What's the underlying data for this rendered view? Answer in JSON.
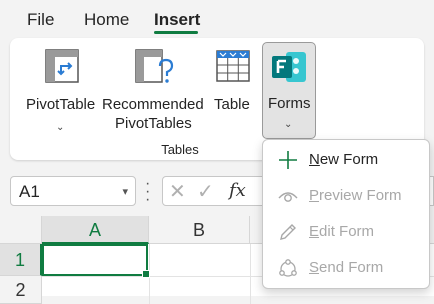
{
  "ribbon_tabs": [
    {
      "label": "File"
    },
    {
      "label": "Home"
    },
    {
      "label": "Insert",
      "active": true
    }
  ],
  "ribbon": {
    "pivottable": {
      "label": "PivotTable",
      "icon": "pivottable-icon"
    },
    "recommended": {
      "label_line1": "Recommended",
      "label_line2": "PivotTables",
      "icon": "recommended-pivottables-icon"
    },
    "table": {
      "label": "Table",
      "icon": "table-icon"
    },
    "forms": {
      "label": "Forms",
      "icon": "microsoft-forms-icon"
    },
    "group_label": "Tables"
  },
  "formula_bar": {
    "name_box": "A1",
    "fx": "fx"
  },
  "grid": {
    "columns": [
      "A",
      "B"
    ],
    "rows": [
      "1",
      "2"
    ],
    "selected_cell": "A1"
  },
  "forms_menu": {
    "items": [
      {
        "accel": "N",
        "rest": "ew Form",
        "enabled": true,
        "icon": "plus-icon"
      },
      {
        "accel": "P",
        "rest": "review Form",
        "enabled": false,
        "icon": "eye-icon"
      },
      {
        "accel": "E",
        "rest": "dit Form",
        "enabled": false,
        "icon": "pencil-icon"
      },
      {
        "accel": "S",
        "rest": "end Form",
        "enabled": false,
        "icon": "share-icon"
      }
    ]
  },
  "colors": {
    "accent": "#107c41",
    "forms_brand": "#03787c",
    "disabled_text": "#a8a8a8"
  }
}
